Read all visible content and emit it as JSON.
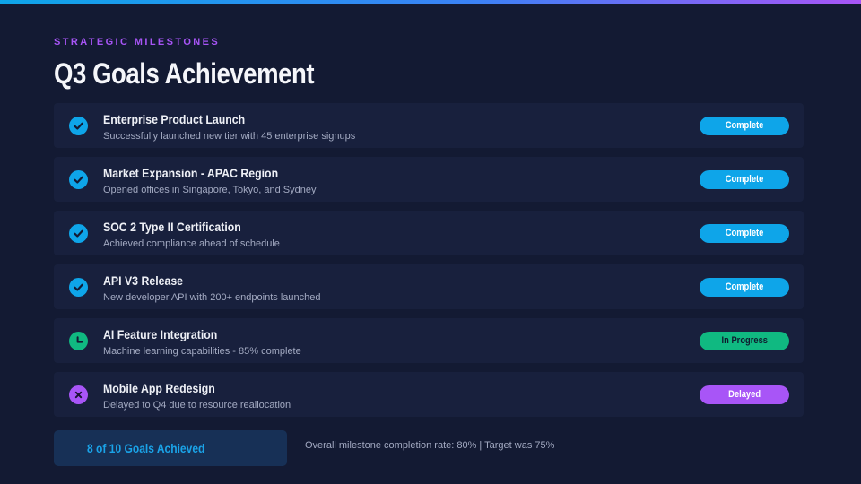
{
  "header": {
    "eyebrow": "STRATEGIC MILESTONES",
    "title": "Q3 Goals Achievement"
  },
  "colors": {
    "complete": "#0ea5e9",
    "in_progress": "#10b981",
    "delayed": "#a855f7",
    "background": "#131a33",
    "row_background": "#18203d"
  },
  "goals": [
    {
      "title": "Enterprise Product Launch",
      "description": "Successfully launched new tier with 45 enterprise signups",
      "status": "Complete",
      "icon": "check-icon"
    },
    {
      "title": "Market Expansion - APAC Region",
      "description": "Opened offices in Singapore, Tokyo, and Sydney",
      "status": "Complete",
      "icon": "check-icon"
    },
    {
      "title": "SOC 2 Type II Certification",
      "description": "Achieved compliance ahead of schedule",
      "status": "Complete",
      "icon": "check-icon"
    },
    {
      "title": "API V3 Release",
      "description": "New developer API with 200+ endpoints launched",
      "status": "Complete",
      "icon": "check-icon"
    },
    {
      "title": "AI Feature Integration",
      "description": "Machine learning capabilities - 85% complete",
      "status": "In Progress",
      "icon": "clock-icon"
    },
    {
      "title": "Mobile App Redesign",
      "description": "Delayed to Q4 due to resource reallocation",
      "status": "Delayed",
      "icon": "x-icon"
    }
  ],
  "summary": {
    "label": "8 of 10 Goals Achieved",
    "text": "Overall milestone completion rate: 80% | Target was 75%"
  }
}
